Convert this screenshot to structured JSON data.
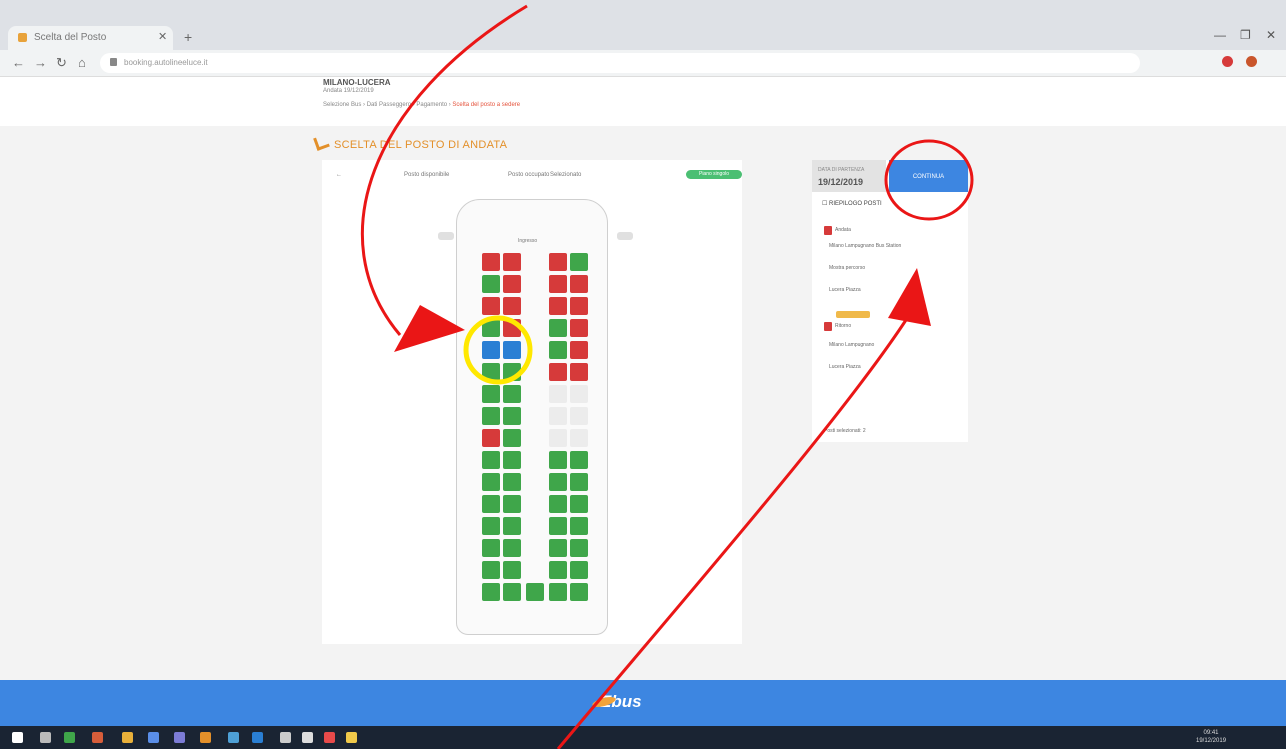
{
  "browser": {
    "tab_title": "Scelta del Posto",
    "new_tab": "+",
    "url": "booking.autolineeluce.it",
    "window_controls": [
      "—",
      "❐",
      "✕"
    ]
  },
  "header": {
    "route": "MILANO-LUCERA",
    "subtitle": "Andata 19/12/2019",
    "breadcrumb_prefix": "Selezione Bus  ›  Dati Passeggero  ›  Pagamento  ›",
    "breadcrumb_active": "Scelta del posto a sedere"
  },
  "section_title": "SCELTA DEL POSTO DI ANDATA",
  "legend": {
    "available": "Posto disponibile",
    "occupied": "Posto occupato",
    "selected": "Selezionato",
    "pill": "Piano singolo"
  },
  "bus_label": "Ingresso",
  "seats": {
    "row1": [
      "taken",
      "taken",
      "taken",
      "free"
    ],
    "row2": [
      "free",
      "taken",
      "taken",
      "taken"
    ],
    "row3": [
      "taken",
      "taken",
      "taken",
      "taken"
    ],
    "row4": [
      "free",
      "taken",
      "free",
      "taken"
    ],
    "row5": [
      "sel",
      "sel",
      "free",
      "taken"
    ],
    "row6": [
      "free",
      "free",
      "taken",
      "taken"
    ]
  },
  "summary": {
    "date_label": "DATA DI PARTENZA",
    "date_value": "19/12/2019",
    "continue_label": "CONTINUA",
    "riepilogo": "RIEPILOGO POSTI",
    "andata_label": "Andata",
    "line1": "Milano Lampugnano Bus Station",
    "line2": "Mostra percorso",
    "line3": "Lucera Piazza",
    "ritorno_label": "Ritorno",
    "line4": "Milano Lampugnano",
    "line5": "Lucera Piazza",
    "posto_label": "Posti selezionati: 2"
  },
  "footer": {
    "logo": "Ebus"
  },
  "taskbar": {
    "time": "09:41",
    "date": "19/12/2019"
  }
}
